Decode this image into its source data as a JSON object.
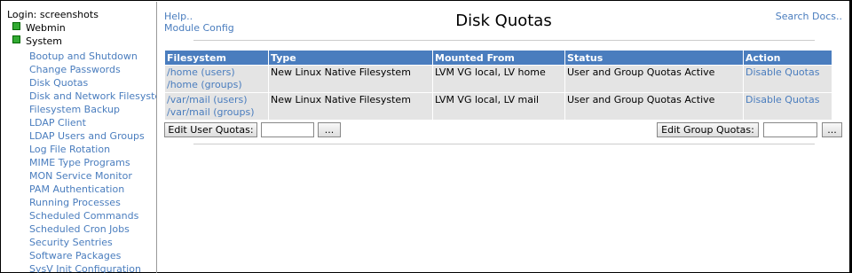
{
  "sidebar": {
    "login": "Login: screenshots",
    "categories": [
      "Webmin",
      "System"
    ],
    "items": [
      "Bootup and Shutdown",
      "Change Passwords",
      "Disk Quotas",
      "Disk and Network Filesystems",
      "Filesystem Backup",
      "LDAP Client",
      "LDAP Users and Groups",
      "Log File Rotation",
      "MIME Type Programs",
      "MON Service Monitor",
      "PAM Authentication",
      "Running Processes",
      "Scheduled Commands",
      "Scheduled Cron Jobs",
      "Security Sentries",
      "Software Packages",
      "SysV Init Configuration"
    ]
  },
  "header": {
    "help": "Help..",
    "module_config": "Module Config",
    "title": "Disk Quotas",
    "search_docs": "Search Docs.."
  },
  "table": {
    "headers": [
      "Filesystem",
      "Type",
      "Mounted From",
      "Status",
      "Action"
    ],
    "rows": [
      {
        "fs_users": "/home (users)",
        "fs_groups": "/home (groups)",
        "type": "New Linux Native Filesystem",
        "mounted_from": "LVM VG local, LV home",
        "status": "User and Group Quotas Active",
        "action": "Disable Quotas"
      },
      {
        "fs_users": "/var/mail (users)",
        "fs_groups": "/var/mail (groups)",
        "type": "New Linux Native Filesystem",
        "mounted_from": "LVM VG local, LV mail",
        "status": "User and Group Quotas Active",
        "action": "Disable Quotas"
      }
    ]
  },
  "controls": {
    "edit_user_quotas": "Edit User Quotas:",
    "edit_group_quotas": "Edit Group Quotas:",
    "browse": "...",
    "user_value": "",
    "group_value": ""
  }
}
